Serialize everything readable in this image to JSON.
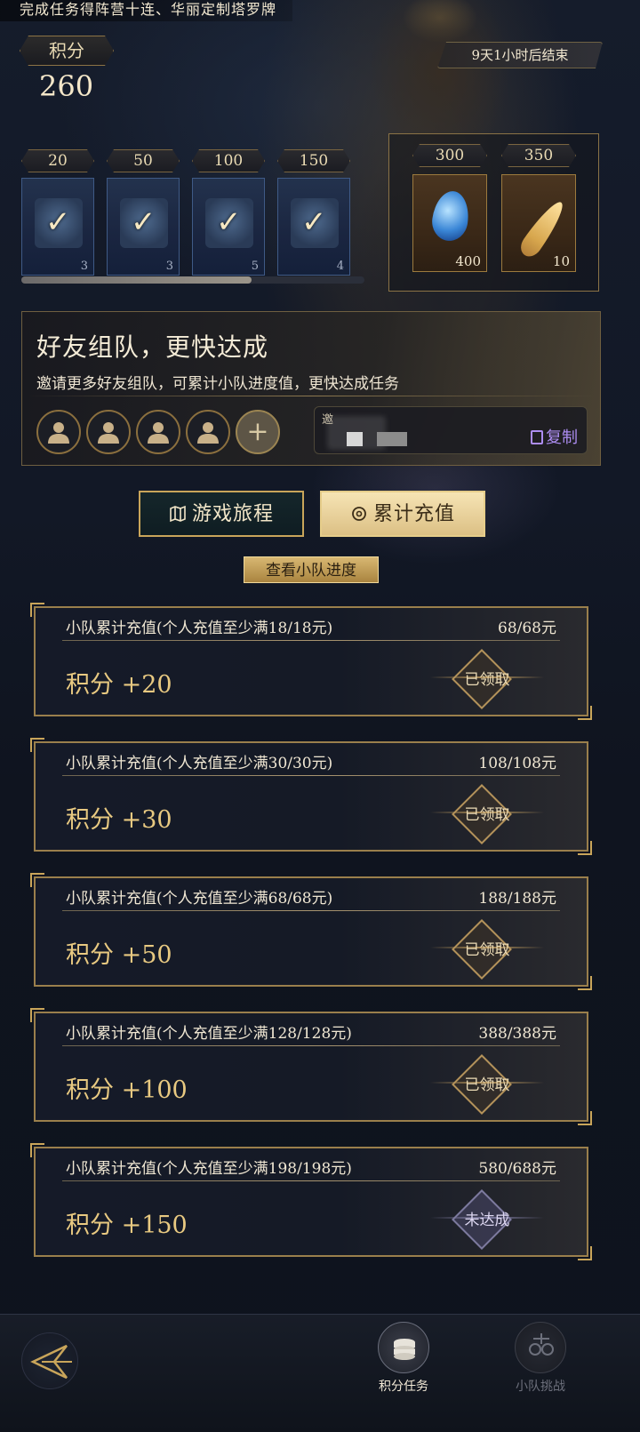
{
  "banner": "完成任务得阵营十连、华丽定制塔罗牌",
  "points": {
    "label": "积分",
    "value": "260"
  },
  "timer": "9天1小时后结束",
  "rewards": [
    {
      "cost": "20",
      "qty": "3",
      "claimed": true
    },
    {
      "cost": "50",
      "qty": "3",
      "claimed": true
    },
    {
      "cost": "100",
      "qty": "5",
      "claimed": true
    },
    {
      "cost": "150",
      "qty": "4",
      "claimed": true
    }
  ],
  "big_rewards": [
    {
      "cost": "300",
      "qty": "400",
      "icon": "blue-gem-icon"
    },
    {
      "cost": "350",
      "qty": "10",
      "icon": "golden-feather-icon"
    }
  ],
  "reward_progress": 0.67,
  "team": {
    "title": "好友组队，更快达成",
    "desc": "邀请更多好友组队，可累计小队进度值，更快达成任务",
    "invite_label": "邀",
    "copy_label": "复制"
  },
  "tabs": {
    "journey": "游戏旅程",
    "recharge": "累计充值"
  },
  "team_progress_btn": "查看小队进度",
  "tasks": [
    {
      "title": "小队累计充值(个人充值至少满18/18元)",
      "progress": "68/68元",
      "reward": "积分 +20",
      "status": "已领取"
    },
    {
      "title": "小队累计充值(个人充值至少满30/30元)",
      "progress": "108/108元",
      "reward": "积分 +30",
      "status": "已领取"
    },
    {
      "title": "小队累计充值(个人充值至少满68/68元)",
      "progress": "188/188元",
      "reward": "积分 +50",
      "status": "已领取"
    },
    {
      "title": "小队累计充值(个人充值至少满128/128元)",
      "progress": "388/388元",
      "reward": "积分 +100",
      "status": "已领取"
    },
    {
      "title": "小队累计充值(个人充值至少满198/198元)",
      "progress": "580/688元",
      "reward": "积分 +150",
      "status": "未达成"
    }
  ],
  "nav": {
    "points_tasks": "积分任务",
    "team_challenge": "小队挑战"
  },
  "colors": {
    "gold": "#c9a55a",
    "bg": "#0f141f",
    "accent_purple": "#ad8df2"
  }
}
